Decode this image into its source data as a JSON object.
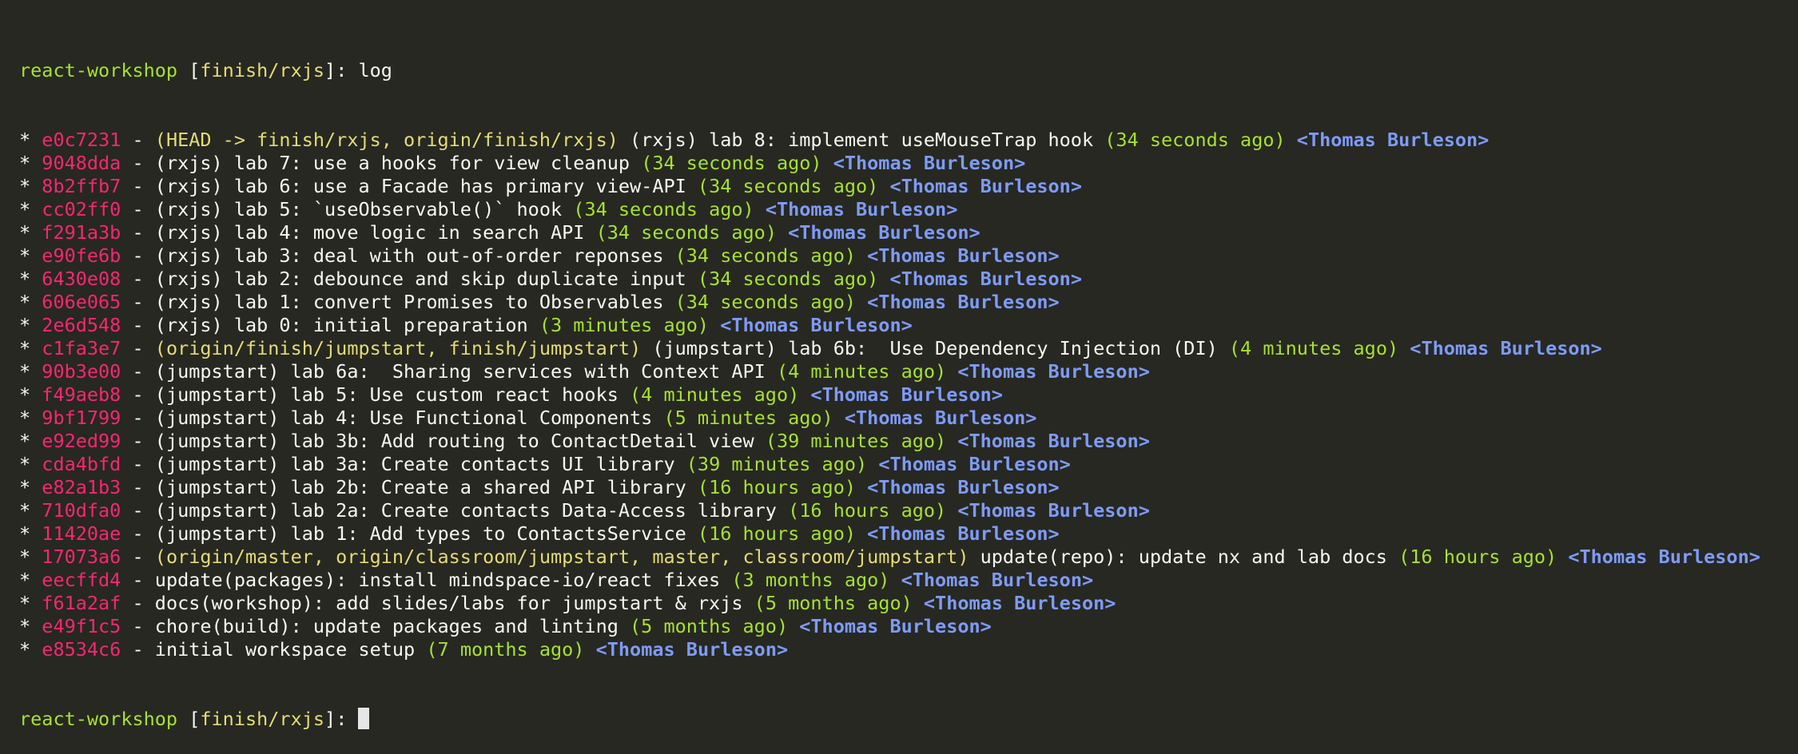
{
  "prompt": {
    "name": "react-workshop",
    "branch": "finish/rxjs",
    "command": "log"
  },
  "commits": [
    {
      "hash": "e0c7231",
      "refs": "(HEAD -> finish/rxjs, origin/finish/rxjs)",
      "message": "(rxjs) lab 8: implement useMouseTrap hook",
      "date": "(34 seconds ago)",
      "author": "<Thomas Burleson>"
    },
    {
      "hash": "9048dda",
      "refs": "",
      "message": "(rxjs) lab 7: use a hooks for view cleanup",
      "date": "(34 seconds ago)",
      "author": "<Thomas Burleson>"
    },
    {
      "hash": "8b2ffb7",
      "refs": "",
      "message": "(rxjs) lab 6: use a Facade has primary view-API",
      "date": "(34 seconds ago)",
      "author": "<Thomas Burleson>"
    },
    {
      "hash": "cc02ff0",
      "refs": "",
      "message": "(rxjs) lab 5: `useObservable()` hook",
      "date": "(34 seconds ago)",
      "author": "<Thomas Burleson>"
    },
    {
      "hash": "f291a3b",
      "refs": "",
      "message": "(rxjs) lab 4: move logic in search API",
      "date": "(34 seconds ago)",
      "author": "<Thomas Burleson>"
    },
    {
      "hash": "e90fe6b",
      "refs": "",
      "message": "(rxjs) lab 3: deal with out-of-order reponses",
      "date": "(34 seconds ago)",
      "author": "<Thomas Burleson>"
    },
    {
      "hash": "6430e08",
      "refs": "",
      "message": "(rxjs) lab 2: debounce and skip duplicate input",
      "date": "(34 seconds ago)",
      "author": "<Thomas Burleson>"
    },
    {
      "hash": "606e065",
      "refs": "",
      "message": "(rxjs) lab 1: convert Promises to Observables",
      "date": "(34 seconds ago)",
      "author": "<Thomas Burleson>"
    },
    {
      "hash": "2e6d548",
      "refs": "",
      "message": "(rxjs) lab 0: initial preparation",
      "date": "(3 minutes ago)",
      "author": "<Thomas Burleson>"
    },
    {
      "hash": "c1fa3e7",
      "refs": "(origin/finish/jumpstart, finish/jumpstart)",
      "message": "(jumpstart) lab 6b:  Use Dependency Injection (DI)",
      "date": "(4 minutes ago)",
      "author": "<Thomas Burleson>"
    },
    {
      "hash": "90b3e00",
      "refs": "",
      "message": "(jumpstart) lab 6a:  Sharing services with Context API",
      "date": "(4 minutes ago)",
      "author": "<Thomas Burleson>"
    },
    {
      "hash": "f49aeb8",
      "refs": "",
      "message": "(jumpstart) lab 5: Use custom react hooks",
      "date": "(4 minutes ago)",
      "author": "<Thomas Burleson>"
    },
    {
      "hash": "9bf1799",
      "refs": "",
      "message": "(jumpstart) lab 4: Use Functional Components",
      "date": "(5 minutes ago)",
      "author": "<Thomas Burleson>"
    },
    {
      "hash": "e92ed99",
      "refs": "",
      "message": "(jumpstart) lab 3b: Add routing to ContactDetail view",
      "date": "(39 minutes ago)",
      "author": "<Thomas Burleson>"
    },
    {
      "hash": "cda4bfd",
      "refs": "",
      "message": "(jumpstart) lab 3a: Create contacts UI library",
      "date": "(39 minutes ago)",
      "author": "<Thomas Burleson>"
    },
    {
      "hash": "e82a1b3",
      "refs": "",
      "message": "(jumpstart) lab 2b: Create a shared API library",
      "date": "(16 hours ago)",
      "author": "<Thomas Burleson>"
    },
    {
      "hash": "710dfa0",
      "refs": "",
      "message": "(jumpstart) lab 2a: Create contacts Data-Access library",
      "date": "(16 hours ago)",
      "author": "<Thomas Burleson>"
    },
    {
      "hash": "11420ae",
      "refs": "",
      "message": "(jumpstart) lab 1: Add types to ContactsService",
      "date": "(16 hours ago)",
      "author": "<Thomas Burleson>"
    },
    {
      "hash": "17073a6",
      "refs": "(origin/master, origin/classroom/jumpstart, master, classroom/jumpstart)",
      "message": "update(repo): update nx and lab docs",
      "date": "(16 hours ago)",
      "author": "<Thomas Burleson>"
    },
    {
      "hash": "eecffd4",
      "refs": "",
      "message": "update(packages): install mindspace-io/react fixes",
      "date": "(3 months ago)",
      "author": "<Thomas Burleson>"
    },
    {
      "hash": "f61a2af",
      "refs": "",
      "message": "docs(workshop): add slides/labs for jumpstart & rxjs",
      "date": "(5 months ago)",
      "author": "<Thomas Burleson>"
    },
    {
      "hash": "e49f1c5",
      "refs": "",
      "message": "chore(build): update packages and linting",
      "date": "(5 months ago)",
      "author": "<Thomas Burleson>"
    },
    {
      "hash": "e8534c6",
      "refs": "",
      "message": "initial workspace setup",
      "date": "(7 months ago)",
      "author": "<Thomas Burleson>"
    }
  ],
  "colors": {
    "background": "#272822",
    "text": "#f8f8f2",
    "hash": "#f92672",
    "refs": "#e6db74",
    "date": "#a6e22e",
    "author": "#7e9bf8",
    "prompt": "#a6e22e"
  }
}
